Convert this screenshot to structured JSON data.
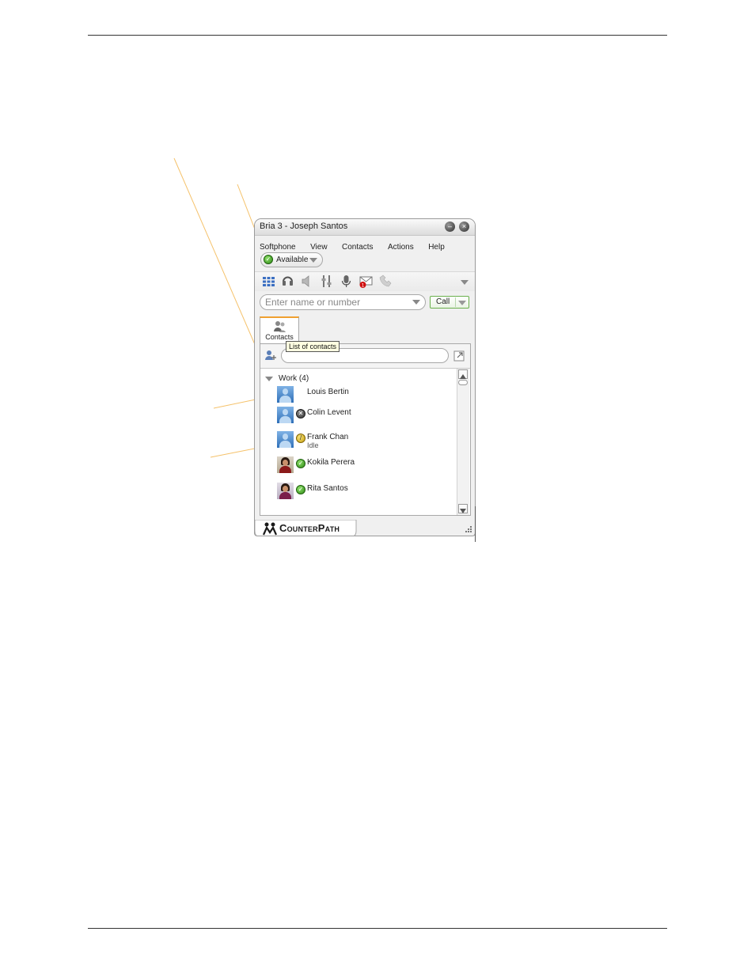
{
  "window": {
    "title": "Bria 3 - Joseph Santos",
    "minimize_glyph": "–",
    "close_glyph": "×"
  },
  "menu": [
    "Softphone",
    "View",
    "Contacts",
    "Actions",
    "Help"
  ],
  "presence": {
    "label": "Available",
    "icon": "available-check-icon"
  },
  "toolbar": {
    "icons": [
      "dialpad-icon",
      "headset-icon",
      "speaker-icon",
      "audio-settings-icon",
      "microphone-icon",
      "voicemail-icon",
      "transfer-icon"
    ],
    "voicemail_badge": "1"
  },
  "dialer": {
    "placeholder": "Enter name or number",
    "call_label": "Call"
  },
  "tabs": [
    {
      "label": "Contacts",
      "icon": "contacts-icon"
    }
  ],
  "contacts": {
    "tooltip": "List of contacts",
    "group": {
      "name": "Work (4)"
    },
    "items": [
      {
        "name": "Louis Bertin",
        "status": "none",
        "sub": ""
      },
      {
        "name": "Colin Levent",
        "status": "offline",
        "sub": ""
      },
      {
        "name": "Frank Chan",
        "status": "idle",
        "sub": "Idle"
      },
      {
        "name": "Kokila Perera",
        "status": "available",
        "sub": ""
      },
      {
        "name": "Rita Santos",
        "status": "available",
        "sub": ""
      }
    ]
  },
  "footer": {
    "brand": "CounterPath"
  },
  "colors": {
    "accent_tab": "#f0a030",
    "call_border": "#6ab04c",
    "callout_line": "#f5c26b",
    "available": "#2f8a16",
    "voicemail_badge": "#d01010"
  }
}
